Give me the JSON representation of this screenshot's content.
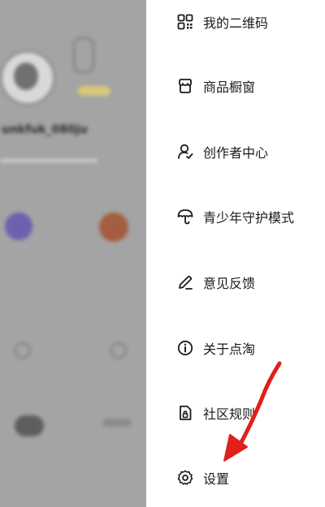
{
  "background_page": {
    "username": "unkfuk_080ju"
  },
  "drawer": {
    "items": [
      {
        "label": "我的二维码",
        "icon": "qr-code-icon"
      },
      {
        "label": "商品橱窗",
        "icon": "storefront-icon"
      },
      {
        "label": "创作者中心",
        "icon": "creator-icon"
      },
      {
        "label": "青少年守护模式",
        "icon": "umbrella-icon"
      },
      {
        "label": "意见反馈",
        "icon": "pencil-icon"
      },
      {
        "label": "关于点淘",
        "icon": "info-icon"
      },
      {
        "label": "社区规则",
        "icon": "rules-doc-icon"
      },
      {
        "label": "设置",
        "icon": "gear-icon"
      }
    ]
  },
  "annotation": {
    "color": "#e0201b",
    "points_to": "设置"
  }
}
